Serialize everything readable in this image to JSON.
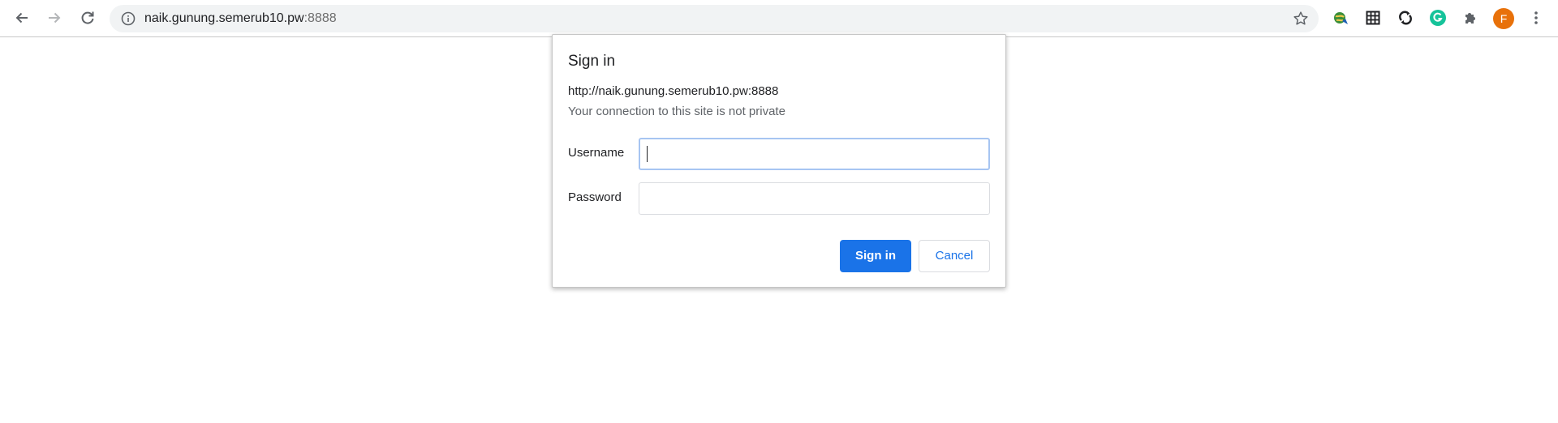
{
  "browser": {
    "url_host": "naik.gunung.semerub10.pw",
    "url_port": ":8888",
    "profile_initial": "F",
    "colors": {
      "toolbar_bg": "#ffffff",
      "omnibox_bg": "#f1f3f4",
      "avatar_bg": "#e8710a",
      "grammarly_green": "#15c39a",
      "accent": "#1a73e8"
    },
    "toolbar_icons": [
      "back-arrow-icon",
      "forward-arrow-icon",
      "reload-icon",
      "site-info-icon",
      "bookmark-star-icon",
      "extension-globe-icon",
      "extension-grid-icon",
      "extension-sync-icon",
      "grammarly-icon",
      "extensions-puzzle-icon",
      "avatar",
      "more-menu-icon"
    ]
  },
  "dialog": {
    "title": "Sign in",
    "origin": "http://naik.gunung.semerub10.pw:8888",
    "warning": "Your connection to this site is not private",
    "username_label": "Username",
    "username_value": "",
    "password_label": "Password",
    "password_value": "",
    "sign_in_label": "Sign in",
    "cancel_label": "Cancel"
  }
}
